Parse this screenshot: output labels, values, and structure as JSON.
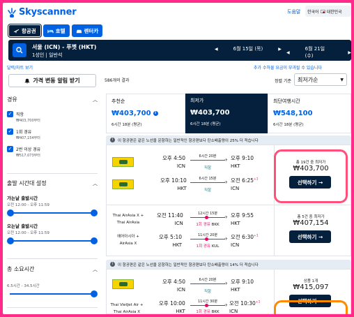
{
  "app": {
    "name": "Skyscanner",
    "brand_color": "#0062e3",
    "dark_color": "#05203c",
    "highlight_gradient": [
      "#e8147a",
      "#ff7a00"
    ]
  },
  "header": {
    "help": "도움말",
    "language": "한국어",
    "region": "대한민국"
  },
  "tabs": [
    {
      "label": "항공권",
      "icon": "plane-icon",
      "active": true
    },
    {
      "label": "호텔",
      "icon": "bed-icon",
      "active": false
    },
    {
      "label": "렌터카",
      "icon": "car-icon",
      "active": false
    }
  ],
  "search": {
    "route": "서울 (ICN) - 푸껫 (HKT)",
    "passengers": "1성인 | 일반석",
    "depart_date": "6월 15일 (목)",
    "return_date": "6월 21일 (수)"
  },
  "subinfo": {
    "left": "달력/차트 보기",
    "right": "추가 수하물 요금이 부과될 수 있습니다"
  },
  "alert_button": "가격 변동 알림 받기",
  "results_count": "586개의 결과",
  "sort": {
    "label": "정렬 기준",
    "value": "최저가순"
  },
  "filters": {
    "stops": {
      "title": "경유",
      "options": [
        {
          "label": "직항",
          "price": "₩403,700부터",
          "checked": true
        },
        {
          "label": "1회 경유",
          "price": "₩407,154부터",
          "checked": true
        },
        {
          "label": "2번 이상 경유",
          "price": "₩517,073부터",
          "checked": true
        }
      ]
    },
    "departure_times": {
      "title": "출발 시간대 설정",
      "outbound": {
        "label": "가는날 출발시간",
        "range": "오전 12:00 - 오후 11:59",
        "start": 0,
        "end": 1
      },
      "inbound": {
        "label": "오는날 출발시간",
        "range": "오전 12:00 - 오후 11:59",
        "start": 0,
        "end": 1
      }
    },
    "duration": {
      "title": "총 소요시간",
      "range": "6.5시간 - 34.5시간",
      "value": 1
    }
  },
  "summary": [
    {
      "title": "추천순",
      "price": "₩403,700",
      "detail": "6시간 18분 (평균)",
      "info": "i",
      "active": false
    },
    {
      "title": "최저가",
      "price": "₩403,700",
      "detail": "6시간 18분 (평균)",
      "active": true
    },
    {
      "title": "최단여행시간",
      "price": "₩548,100",
      "detail": "6시간 18분 (평균)",
      "active": false
    }
  ],
  "banners": [
    {
      "text": "이 항공편은 같은 노선을 운항하는 일반적인 항공편보다 탄소배출량이 25% 더 적습니다",
      "icon": "i"
    },
    {
      "text": "이 항공편은 같은 노선을 운항하는 일반적인 항공편보다 탄소배출량이 14% 더 적습니다",
      "icon": "i"
    }
  ],
  "results": [
    {
      "airline_text": [],
      "legs": [
        {
          "dep": "오후 4:50",
          "from": "ICN",
          "duration": "6시간 20분",
          "stop": "직항",
          "arr": "오후 9:10",
          "to": "HKT",
          "plus": ""
        },
        {
          "dep": "오후 10:10",
          "from": "HKT",
          "duration": "6시간 15분",
          "stop": "직항",
          "arr": "오전 6:25",
          "to": "ICN",
          "plus": "+1"
        }
      ],
      "price_label": "총 19건 중 최저가",
      "price": "₩403,700",
      "button": "선택하기 →"
    },
    {
      "airline_text": [
        "Thai AirAsia X +",
        "Thai AirAsia",
        "에어아시아 +",
        "AirAsia X"
      ],
      "legs": [
        {
          "dep": "오전 11:40",
          "from": "ICN",
          "duration": "12시간 15분",
          "stop": "1회 경유",
          "via": "BKK",
          "arr": "오후 9:55",
          "to": "HKT",
          "plus": ""
        },
        {
          "dep": "오후 5:10",
          "from": "HKT",
          "duration": "11시간 20분",
          "stop": "1회 경유",
          "via": "KUL",
          "arr": "오전 6:30",
          "to": "ICN",
          "plus": "+1"
        }
      ],
      "price_label": "총 5건 중 최저가",
      "price": "₩407,154",
      "button": "선택하기 →"
    },
    {
      "airline_text": [
        "Thai VietJet Air +",
        "Thai AirAsia X"
      ],
      "legs": [
        {
          "dep": "오후 4:50",
          "from": "ICN",
          "duration": "6시간 20분",
          "stop": "직항",
          "arr": "오후 9:10",
          "to": "HKT",
          "plus": ""
        },
        {
          "dep": "오후 10:00",
          "from": "HKT",
          "duration": "11시간 30분",
          "stop": "1회 경유",
          "via": "BKK",
          "arr": "오전 10:30",
          "to": "ICN",
          "plus": "+1"
        }
      ],
      "price_label": "상품 1개",
      "price": "₩415,097",
      "button": "선택하기 →"
    }
  ]
}
